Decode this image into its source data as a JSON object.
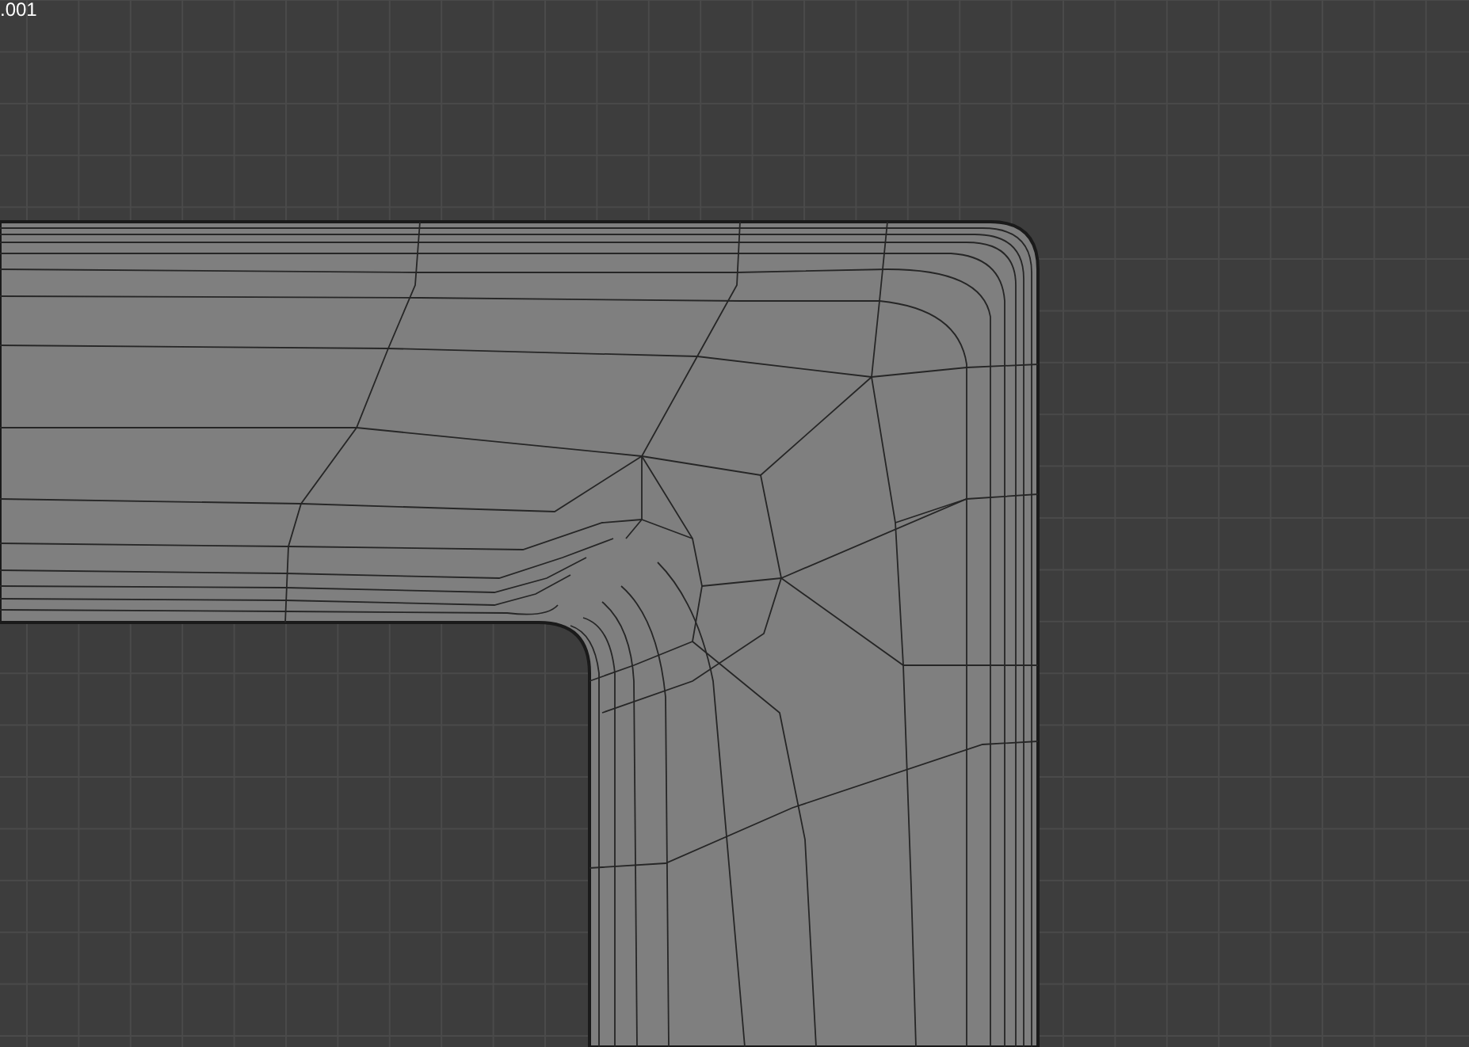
{
  "viewport": {
    "overlay_text": ".001"
  }
}
